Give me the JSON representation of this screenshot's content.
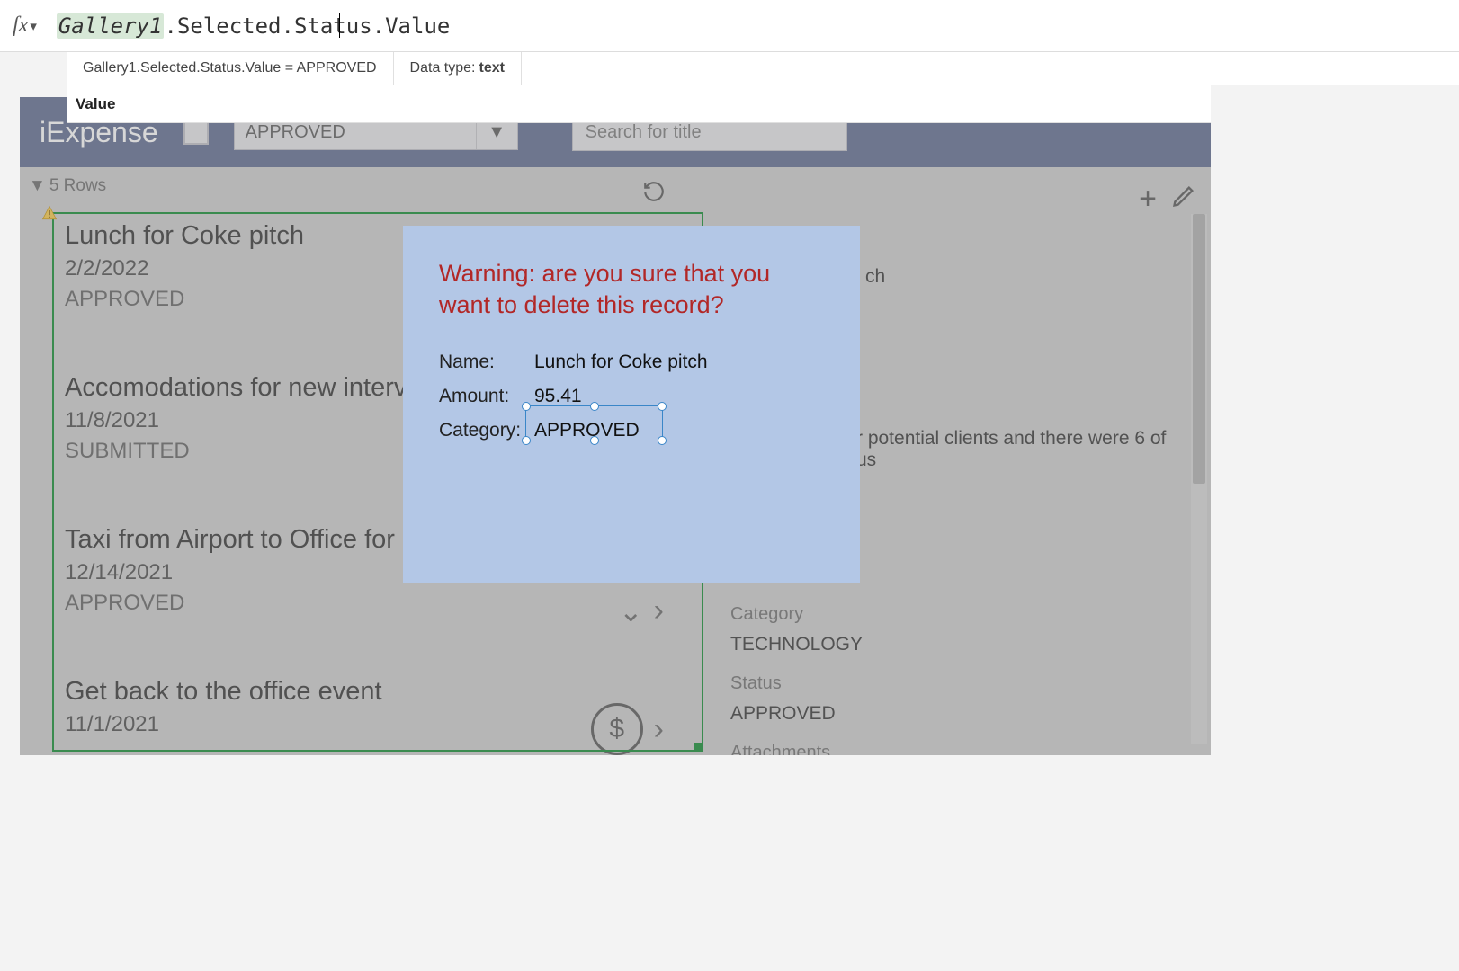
{
  "formula_bar": {
    "fx_label": "fx",
    "highlighted": "Gallery1",
    "rest": ".Selected.Status.Value",
    "eval_text": "Gallery1.Selected.Status.Value  =  APPROVED",
    "type_label": "Data type: ",
    "type_value": "text",
    "autocomplete": "Value"
  },
  "app": {
    "title": "iExpense",
    "dropdown_value": "APPROVED",
    "search_placeholder": "Search for title"
  },
  "gallery": {
    "row_summary": "5 Rows",
    "items": [
      {
        "title": "Lunch for Coke pitch",
        "date": "2/2/2022",
        "status": "APPROVED"
      },
      {
        "title": "Accomodations for new interv",
        "date": "11/8/2021",
        "status": "SUBMITTED"
      },
      {
        "title": "Taxi from Airport to Office for",
        "date": "12/14/2021",
        "status": "APPROVED"
      },
      {
        "title": "Get back to the office event",
        "date": "11/1/2021",
        "status": ""
      }
    ]
  },
  "detail": {
    "title_suffix": "ch",
    "desc_fragment": "r potential clients and there were 6 of us",
    "category_label": "Category",
    "category_value": "TECHNOLOGY",
    "status_label": "Status",
    "status_value": "APPROVED",
    "attachments_label": "Attachments"
  },
  "dialog": {
    "warning": "Warning: are you sure that you want to delete this record?",
    "name_label": "Name:",
    "name_value": "Lunch for Coke pitch",
    "amount_label": "Amount:",
    "amount_value": "95.41",
    "category_label": "Category:",
    "category_value": "APPROVED"
  }
}
